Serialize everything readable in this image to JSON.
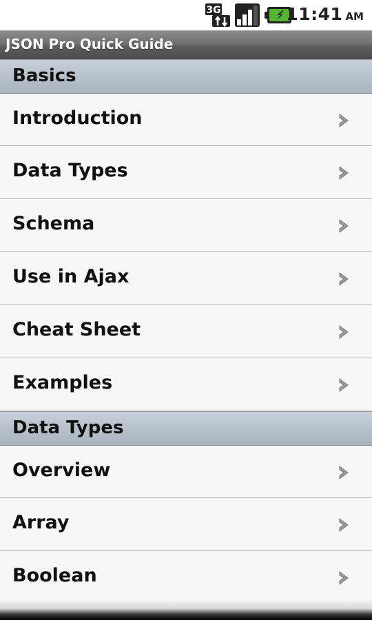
{
  "status_bar": {
    "time": "11:41",
    "ampm": "AM",
    "network_icon": "3g-data-icon",
    "signal_icon": "signal-strength-icon",
    "battery_icon": "battery-charging-icon",
    "battery_color": "#55b531"
  },
  "app": {
    "title": "JSON Pro Quick Guide"
  },
  "sections": [
    {
      "title": "Basics",
      "items": [
        {
          "label": "Introduction"
        },
        {
          "label": "Data Types"
        },
        {
          "label": "Schema"
        },
        {
          "label": "Use in Ajax"
        },
        {
          "label": "Cheat Sheet"
        },
        {
          "label": "Examples"
        }
      ]
    },
    {
      "title": "Data Types",
      "items": [
        {
          "label": "Overview"
        },
        {
          "label": "Array"
        },
        {
          "label": "Boolean"
        }
      ]
    }
  ],
  "list_item_icon": "chevron-right-icon"
}
